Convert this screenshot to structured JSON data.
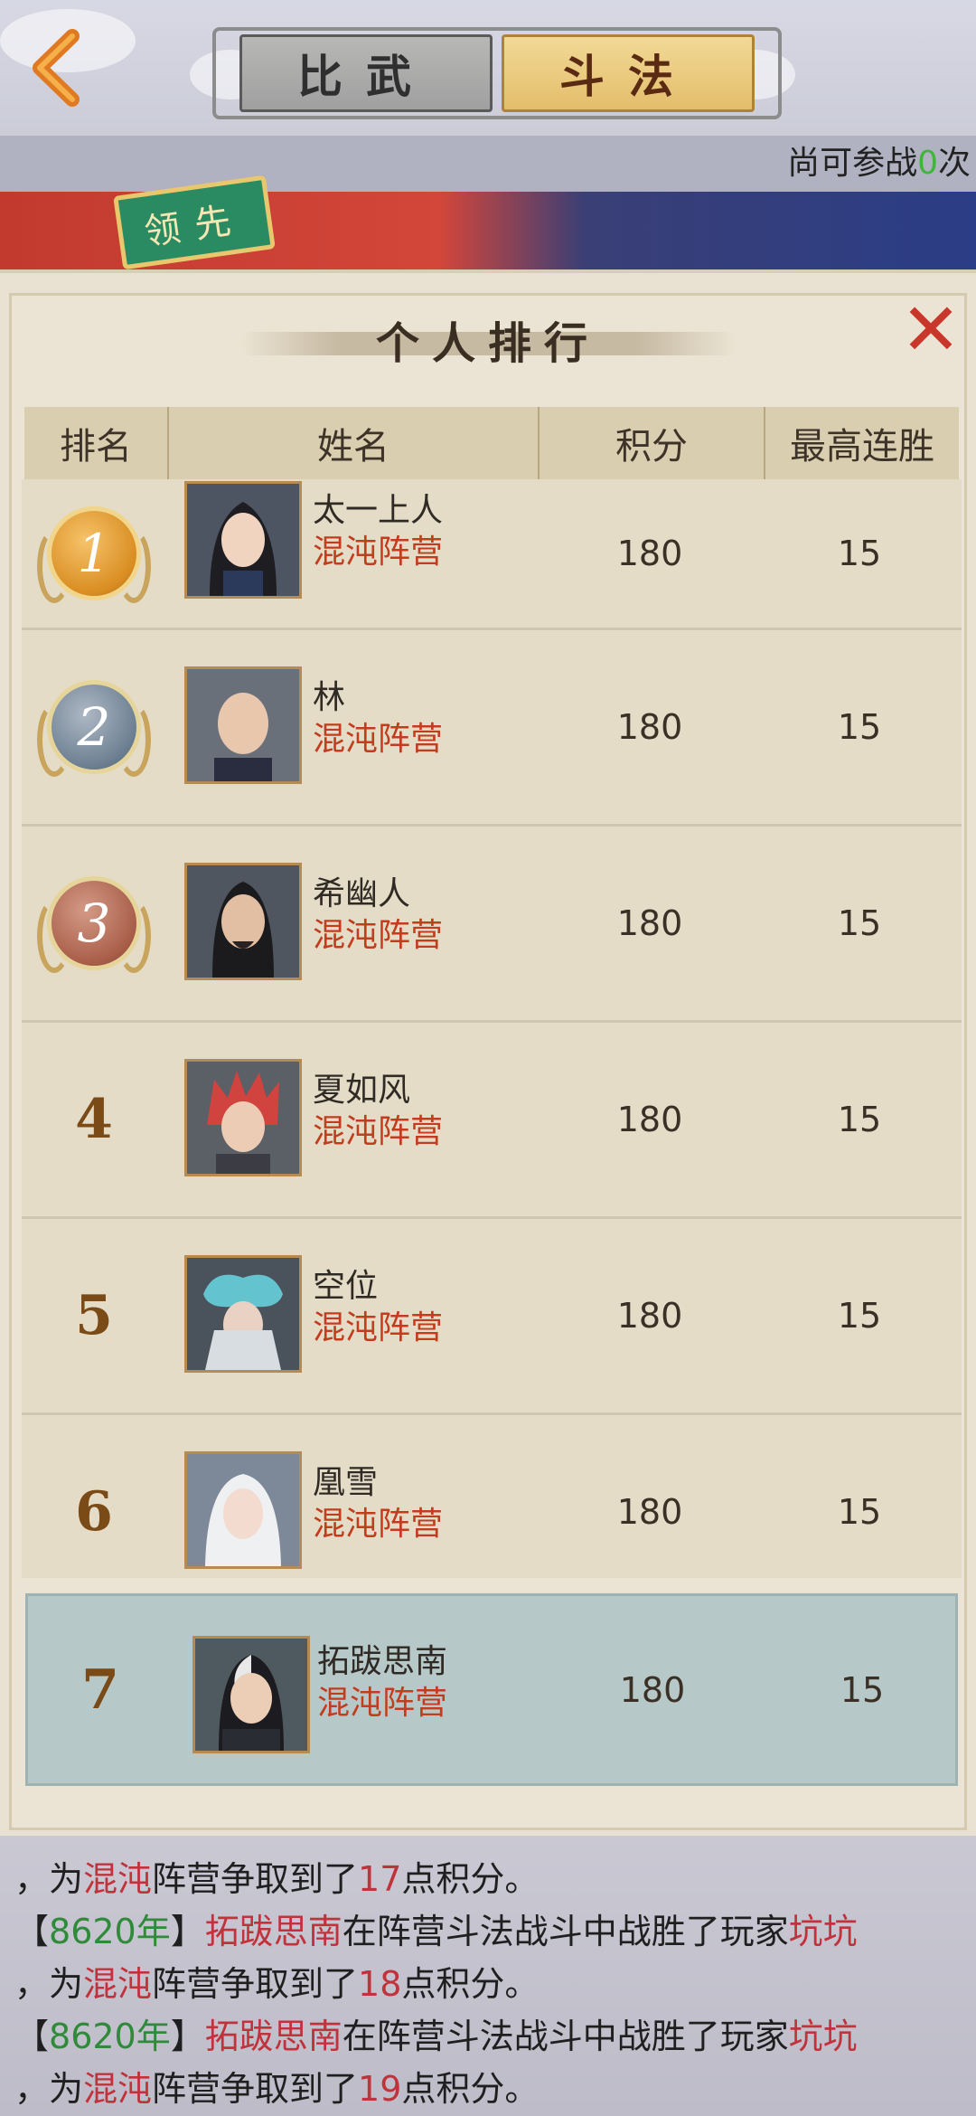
{
  "top": {
    "tabs": [
      {
        "label": "比武",
        "active": false
      },
      {
        "label": "斗法",
        "active": true
      }
    ],
    "attempts_prefix": "尚可参战",
    "attempts_count": "0",
    "attempts_suffix": "次",
    "banner_badge": "领先"
  },
  "panel": {
    "title": "个人排行",
    "close_icon": "close-x-icon",
    "columns": [
      "排名",
      "姓名",
      "积分",
      "最高连胜"
    ],
    "rows": [
      {
        "rank": "1",
        "medal": "gold",
        "name": "太一上人",
        "camp": "混沌阵营",
        "score": "180",
        "streak": "15"
      },
      {
        "rank": "2",
        "medal": "silver",
        "name": "林",
        "camp": "混沌阵营",
        "score": "180",
        "streak": "15"
      },
      {
        "rank": "3",
        "medal": "bronze",
        "name": "希幽人",
        "camp": "混沌阵营",
        "score": "180",
        "streak": "15"
      },
      {
        "rank": "4",
        "medal": "",
        "name": "夏如风",
        "camp": "混沌阵营",
        "score": "180",
        "streak": "15"
      },
      {
        "rank": "5",
        "medal": "",
        "name": "空位",
        "camp": "混沌阵营",
        "score": "180",
        "streak": "15"
      },
      {
        "rank": "6",
        "medal": "",
        "name": "凰雪",
        "camp": "混沌阵营",
        "score": "180",
        "streak": "15"
      }
    ],
    "self_row": {
      "rank": "7",
      "name": "拓跋思南",
      "camp": "混沌阵营",
      "score": "180",
      "streak": "15"
    }
  },
  "log": {
    "lines": [
      [
        {
          "t": "，为",
          "c": ""
        },
        {
          "t": "混沌",
          "c": "red"
        },
        {
          "t": "阵营争取到了",
          "c": ""
        },
        {
          "t": "17",
          "c": "red"
        },
        {
          "t": "点积分。",
          "c": ""
        }
      ],
      [
        {
          "t": "【",
          "c": ""
        },
        {
          "t": "8620年",
          "c": "green"
        },
        {
          "t": "】",
          "c": ""
        },
        {
          "t": "拓跋思南",
          "c": "red"
        },
        {
          "t": "在阵营斗法战斗中战胜了玩家",
          "c": ""
        },
        {
          "t": "坑坑",
          "c": "red"
        }
      ],
      [
        {
          "t": "，为",
          "c": ""
        },
        {
          "t": "混沌",
          "c": "red"
        },
        {
          "t": "阵营争取到了",
          "c": ""
        },
        {
          "t": "18",
          "c": "red"
        },
        {
          "t": "点积分。",
          "c": ""
        }
      ],
      [
        {
          "t": "【",
          "c": ""
        },
        {
          "t": "8620年",
          "c": "green"
        },
        {
          "t": "】",
          "c": ""
        },
        {
          "t": "拓跋思南",
          "c": "red"
        },
        {
          "t": "在阵营斗法战斗中战胜了玩家",
          "c": ""
        },
        {
          "t": "坑坑",
          "c": "red"
        }
      ],
      [
        {
          "t": "，为",
          "c": ""
        },
        {
          "t": "混沌",
          "c": "red"
        },
        {
          "t": "阵营争取到了",
          "c": ""
        },
        {
          "t": "19",
          "c": "red"
        },
        {
          "t": "点积分。",
          "c": ""
        }
      ]
    ]
  }
}
